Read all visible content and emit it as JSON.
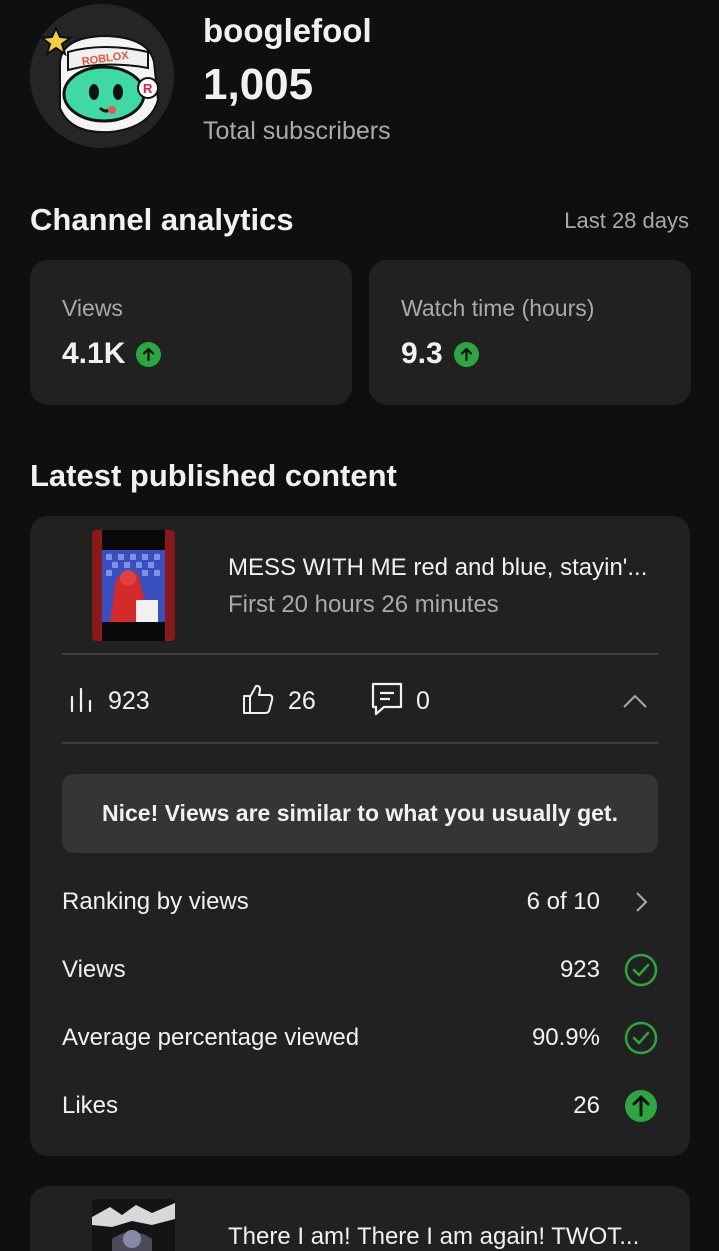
{
  "channel": {
    "name": "booglefool",
    "subscriber_count": "1,005",
    "subscriber_label": "Total subscribers",
    "avatar_logo_text": "ROBLOX",
    "avatar_badge_text": "R"
  },
  "analytics": {
    "title": "Channel analytics",
    "period": "Last 28 days",
    "stats": [
      {
        "label": "Views",
        "value": "4.1K",
        "trend": "up"
      },
      {
        "label": "Watch time (hours)",
        "value": "9.3",
        "trend": "up"
      }
    ]
  },
  "latest": {
    "title": "Latest published content",
    "videos": [
      {
        "title": "MESS WITH ME red and blue, stayin'...",
        "period": "First 20 hours 26 minutes",
        "views": "923",
        "likes": "26",
        "comments": "0",
        "insight": "Nice! Views are similar to what you usually get.",
        "details": [
          {
            "label": "Ranking by views",
            "value": "6 of 10",
            "icon": "chevron-right-icon"
          },
          {
            "label": "Views",
            "value": "923",
            "icon": "check-circle-icon"
          },
          {
            "label": "Average percentage viewed",
            "value": "90.9%",
            "icon": "check-circle-icon"
          },
          {
            "label": "Likes",
            "value": "26",
            "icon": "up-arrow-circle-icon"
          }
        ]
      },
      {
        "title": "There I am! There I am again! TWOT..."
      }
    ]
  },
  "colors": {
    "background": "#0f0f0f",
    "card": "#212121",
    "accent_green": "#2ba640",
    "secondary_text": "#aaaaaa"
  }
}
